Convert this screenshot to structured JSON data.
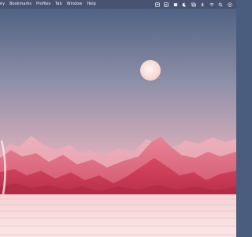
{
  "menubar": {
    "items": [
      {
        "label": "ory"
      },
      {
        "label": "Bookmarks"
      },
      {
        "label": "Profiles"
      },
      {
        "label": "Tab"
      },
      {
        "label": "Window"
      },
      {
        "label": "Help"
      }
    ],
    "status_icons": [
      "dashboard-icon",
      "menu-list-icon",
      "menu-box-icon",
      "moon-icon",
      "screen-mirroring-icon",
      "bluetooth-icon",
      "wifi-icon",
      "search-icon",
      "user-icon"
    ]
  },
  "wallpaper": {
    "scene": "desert-sunset",
    "colors": {
      "sky_top": "#4a5d7f",
      "sky_mid": "#b7a9bd",
      "sky_horizon": "#f3b7c0",
      "moon": "#fce3df",
      "mountains_back": "#f0a9b6",
      "mountains_mid": "#de6f85",
      "mountains_front": "#c93a55",
      "floor": "#fae2e2",
      "floor_lines": "#e8b8be"
    }
  }
}
